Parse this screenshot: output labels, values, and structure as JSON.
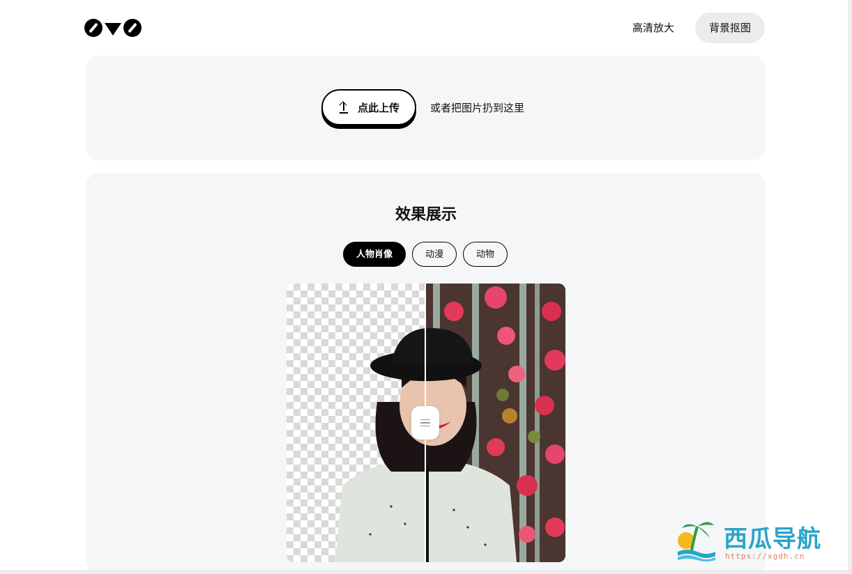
{
  "nav": {
    "upscale_label": "高清放大",
    "remove_bg_label": "背景抠图"
  },
  "upload": {
    "button_label": "点此上传",
    "hint": "或者把图片扔到这里"
  },
  "demo": {
    "title": "效果展示",
    "tabs": [
      {
        "label": "人物肖像",
        "active": true
      },
      {
        "label": "动漫",
        "active": false
      },
      {
        "label": "动物",
        "active": false
      }
    ],
    "compare_position_percent": 50
  },
  "watermark": {
    "title": "西瓜导航",
    "url": "https://xgdh.cn"
  },
  "colors": {
    "panel_bg": "#f5f6f7",
    "accent": "#000000",
    "watermark_blue": "#2aa4c8"
  }
}
